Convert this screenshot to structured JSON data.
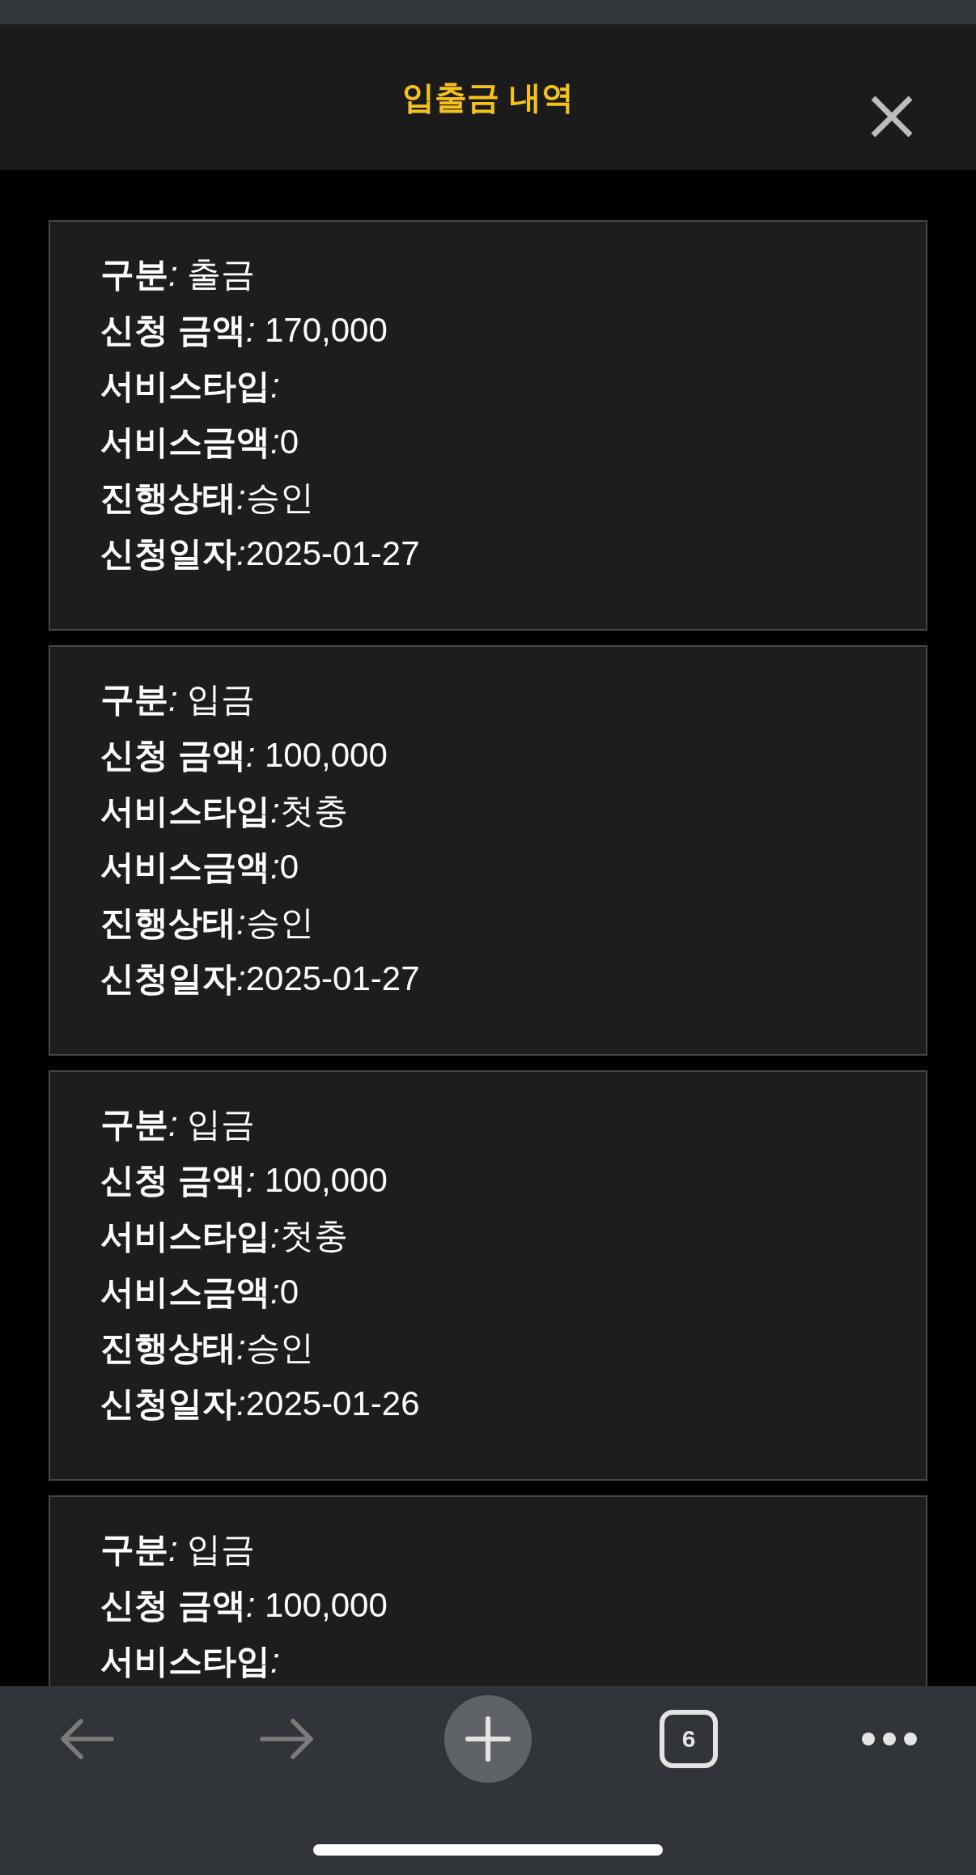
{
  "header": {
    "title": "입출금 내역"
  },
  "cards": [
    {
      "rows": [
        {
          "label": "구분",
          "separator": ":",
          "value": " 출금"
        },
        {
          "label": "신청 금액",
          "separator": ":",
          "value": " 170,000"
        },
        {
          "label": "서비스타입",
          "separator": ":"
        },
        {
          "label": "서비스금액",
          "separator": ":",
          "value": "0"
        },
        {
          "label": "진행상태",
          "separator": ":",
          "value": "승인"
        },
        {
          "label": "신청일자",
          "separator": ":",
          "value": "2025-01-27"
        }
      ]
    },
    {
      "rows": [
        {
          "label": "구분",
          "separator": ":",
          "value": " 입금"
        },
        {
          "label": "신청 금액",
          "separator": ":",
          "value": " 100,000"
        },
        {
          "label": "서비스타입",
          "separator": ":",
          "value": "첫충"
        },
        {
          "label": "서비스금액",
          "separator": ":",
          "value": "0"
        },
        {
          "label": "진행상태",
          "separator": ":",
          "value": "승인"
        },
        {
          "label": "신청일자",
          "separator": ":",
          "value": "2025-01-27"
        }
      ]
    },
    {
      "rows": [
        {
          "label": "구분",
          "separator": ":",
          "value": " 입금"
        },
        {
          "label": "신청 금액",
          "separator": ":",
          "value": " 100,000"
        },
        {
          "label": "서비스타입",
          "separator": ":",
          "value": "첫충"
        },
        {
          "label": "서비스금액",
          "separator": ":",
          "value": "0"
        },
        {
          "label": "진행상태",
          "separator": ":",
          "value": "승인"
        },
        {
          "label": "신청일자",
          "separator": ":",
          "value": "2025-01-26"
        }
      ]
    },
    {
      "rows": [
        {
          "label": "구분",
          "separator": ":",
          "value": " 입금"
        },
        {
          "label": "신청 금액",
          "separator": ":",
          "value": " 100,000"
        },
        {
          "label": "서비스타입",
          "separator": ":"
        }
      ]
    }
  ],
  "toolbar": {
    "buttons": [
      {
        "kind": "back",
        "disabled": true
      },
      {
        "kind": "forward",
        "disabled": true
      },
      {
        "kind": "new-tab",
        "disabled": false
      },
      {
        "kind": "tabs",
        "label": "6",
        "disabled": false
      },
      {
        "kind": "more",
        "disabled": false
      }
    ]
  }
}
